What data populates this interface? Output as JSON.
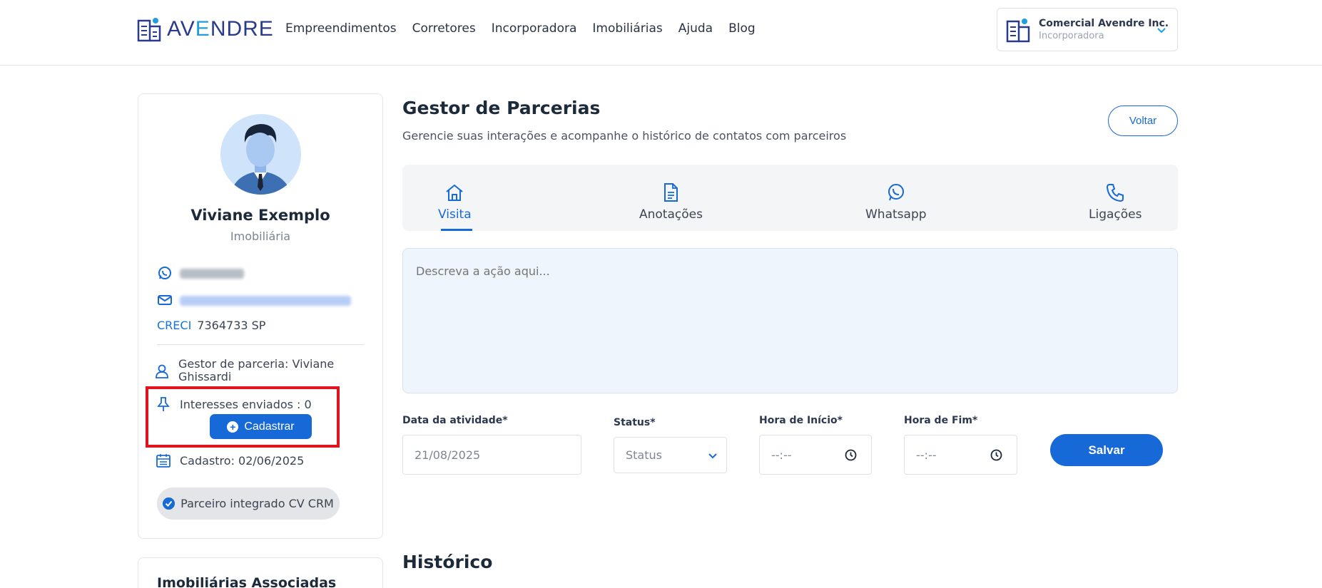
{
  "header": {
    "logo_text_a": "AV",
    "logo_text_e": "E",
    "logo_text_rest": "NDRE",
    "nav": [
      "Empreendimentos",
      "Corretores",
      "Incorporadora",
      "Imobiliárias",
      "Ajuda",
      "Blog"
    ],
    "account_name": "Comercial Avendre Inc.",
    "account_role": "Incorporadora"
  },
  "profile": {
    "name": "Viviane Exemplo",
    "type": "Imobiliária",
    "creci_label": "CRECI",
    "creci_value": "7364733 SP",
    "gestor": "Gestor de parceria: Viviane Ghissardi",
    "interesses": "Interesses enviados : 0",
    "cadastrar_label": "Cadastrar",
    "cadastro": "Cadastro: 02/06/2025",
    "crm_badge": "Parceiro integrado CV CRM",
    "associadas_title": "Imobiliárias Associadas"
  },
  "main": {
    "title": "Gestor de Parcerias",
    "subtitle": "Gerencie suas interações e acompanhe o histórico de contatos com parceiros",
    "voltar_label": "Voltar",
    "tabs": [
      {
        "label": "Visita",
        "icon": "home-icon"
      },
      {
        "label": "Anotações",
        "icon": "document-icon"
      },
      {
        "label": "Whatsapp",
        "icon": "whatsapp-icon"
      },
      {
        "label": "Ligações",
        "icon": "phone-icon"
      }
    ],
    "active_tab": "Visita",
    "description_placeholder": "Descreva a ação aqui...",
    "form": {
      "data_label": "Data da atividade*",
      "data_value": "21/08/2025",
      "status_label": "Status*",
      "status_value": "Status",
      "inicio_label": "Hora de Início*",
      "inicio_value": "--:--",
      "fim_label": "Hora de Fim*",
      "fim_value": "--:--",
      "salvar_label": "Salvar"
    },
    "historico_title": "Histórico"
  },
  "colors": {
    "accent": "#1769d8",
    "highlight": "#e0141c",
    "logo_dark": "#2a3a8c",
    "logo_light": "#1f9de0"
  }
}
